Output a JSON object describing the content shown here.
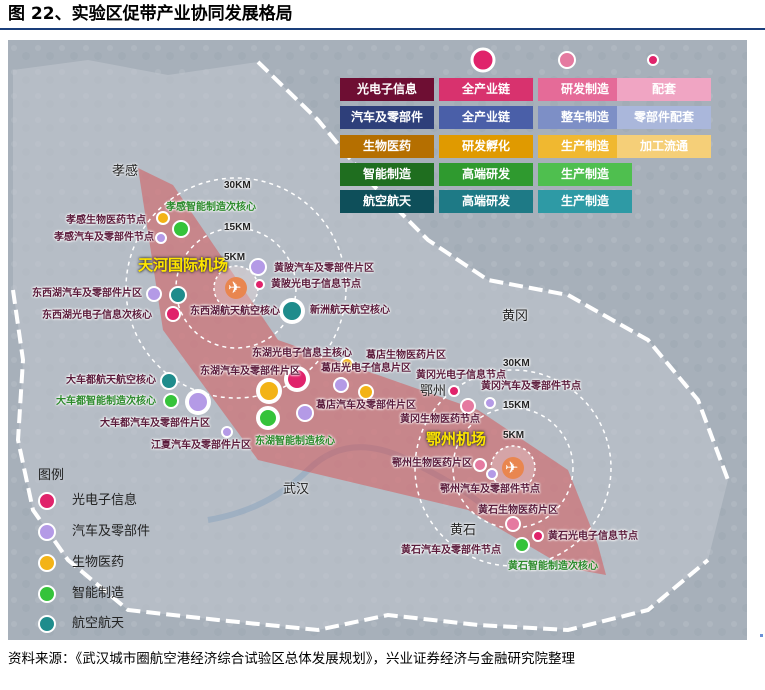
{
  "figure": {
    "title": "图 22、实验区促带产业协同发展格局",
    "source": "资料来源：《武汉城市圈航空港经济综合试验区总体发展规划》，兴业证券经济与金融研究院整理"
  },
  "table": {
    "rows": [
      {
        "cells": [
          "光电子信息",
          "全产业链",
          "研发制造",
          "配套"
        ],
        "colors": [
          "#6e0e33",
          "#d8326e",
          "#e56b98",
          "#f0a5c3"
        ]
      },
      {
        "cells": [
          "汽车及零部件",
          "全产业链",
          "整车制造",
          "零部件配套"
        ],
        "colors": [
          "#2e3f7a",
          "#4a5fa8",
          "#7d8fc6",
          "#aab7db"
        ]
      },
      {
        "cells": [
          "生物医药",
          "研发孵化",
          "生产制造",
          "加工流通"
        ],
        "colors": [
          "#b56f00",
          "#e09a00",
          "#f0b830",
          "#f5cf78"
        ]
      },
      {
        "cells": [
          "智能制造",
          "高端研发",
          "生产制造",
          ""
        ],
        "colors": [
          "#1f6e1f",
          "#2f9a2f",
          "#4fbf4f",
          ""
        ]
      },
      {
        "cells": [
          "航空航天",
          "高端研发",
          "生产制造",
          ""
        ],
        "colors": [
          "#0e4f5a",
          "#1e7a86",
          "#2e9aa5",
          ""
        ]
      }
    ]
  },
  "size_legend": {
    "colors": [
      "#e0236b",
      "#e57aa0",
      "#e0236b"
    ]
  },
  "legend": {
    "title": "图例",
    "items": [
      {
        "label": "光电子信息",
        "color": "#e0236b"
      },
      {
        "label": "汽车及零部件",
        "color": "#b49ae6"
      },
      {
        "label": "生物医药",
        "color": "#f3b316"
      },
      {
        "label": "智能制造",
        "color": "#35c33a"
      },
      {
        "label": "航空航天",
        "color": "#1f8c8c"
      }
    ]
  },
  "places": {
    "xiaogan": "孝感",
    "huanggang": "黄冈",
    "ezhou": "鄂州",
    "wuhan": "武汉",
    "huangshi": "黄石",
    "tianhe_airport": "天河国际机场",
    "ezhou_airport": "鄂州机场"
  },
  "rings": {
    "tianhe": [
      "30KM",
      "15KM",
      "5KM"
    ],
    "ezhou": [
      "30KM",
      "15KM",
      "5KM"
    ]
  },
  "nodes": {
    "n1": "孝感生物医药节点",
    "n2": "孝感智能制造次核心",
    "n3": "孝感汽车及零部件节点",
    "n4": "黄陂汽车及零部件片区",
    "n5": "黄陂光电子信息节点",
    "n6": "东西湖汽车及零部件片区",
    "n7": "东西湖光电子信息次核心",
    "n8": "东西湖航天航空核心",
    "n9": "新洲航天航空核心",
    "n10": "东湖光电子信息主核心",
    "n11": "葛店生物医药片区",
    "n12": "东湖汽车及零部件片区",
    "n13": "葛店光电子信息片区",
    "n14": "葛店汽车及零部件片区",
    "n15": "大车都航天航空核心",
    "n16": "大车都智能制造次核心",
    "n17": "大车都汽车及零部件片区",
    "n18": "江夏汽车及零部件片区",
    "n19": "东湖智能制造核心",
    "n20": "黄冈光电子信息节点",
    "n21": "黄冈汽车及零部件节点",
    "n22": "黄冈生物医药节点",
    "n23": "鄂州生物医药片区",
    "n24": "鄂州汽车及零部件节点",
    "n25": "黄石生物医药片区",
    "n26": "黄石光电子信息节点",
    "n27": "黄石汽车及零部件节点",
    "n28": "黄石智能制造次核心"
  }
}
